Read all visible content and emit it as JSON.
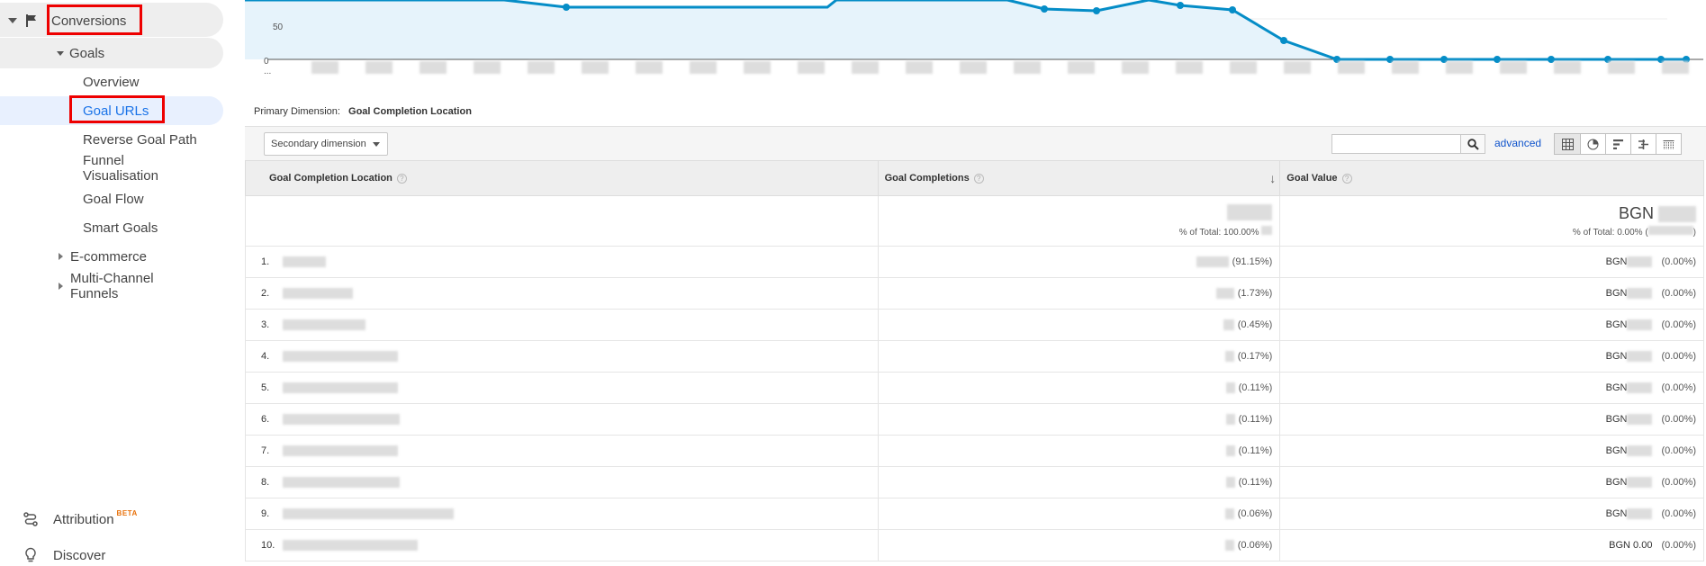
{
  "sidebar": {
    "conversions": "Conversions",
    "goals": "Goals",
    "overview": "Overview",
    "goal_urls": "Goal URLs",
    "reverse_goal_path": "Reverse Goal Path",
    "funnel_line1": "Funnel",
    "funnel_line2": "Visualisation",
    "goal_flow": "Goal Flow",
    "smart_goals": "Smart Goals",
    "ecommerce": "E-commerce",
    "mcf_line1": "Multi-Channel",
    "mcf_line2": "Funnels",
    "attribution": "Attribution",
    "beta": "BETA",
    "discover": "Discover"
  },
  "chart": {
    "y_tick": "50",
    "y_zero": "0",
    "x_ellipsis": "..."
  },
  "primary_dimension": {
    "label": "Primary Dimension:",
    "value": "Goal Completion Location"
  },
  "toolbar": {
    "secondary_dimension": "Secondary dimension",
    "advanced": "advanced"
  },
  "table": {
    "headers": [
      "Goal Completion Location",
      "Goal Completions",
      "Goal Value"
    ],
    "totals": {
      "completions_sub": "% of Total: 100.00%",
      "value_prefix": "BGN",
      "value_sub": "% of Total: 0.00% ("
    },
    "rows": [
      {
        "n": "1.",
        "pct": "(91.15%)",
        "val": "BGN",
        "val_pct": "(0.00%)"
      },
      {
        "n": "2.",
        "pct": "(1.73%)",
        "val": "BGN",
        "val_pct": "(0.00%)"
      },
      {
        "n": "3.",
        "pct": "(0.45%)",
        "val": "BGN",
        "val_pct": "(0.00%)"
      },
      {
        "n": "4.",
        "pct": "(0.17%)",
        "val": "BGN",
        "val_pct": "(0.00%)"
      },
      {
        "n": "5.",
        "pct": "(0.11%)",
        "val": "BGN",
        "val_pct": "(0.00%)"
      },
      {
        "n": "6.",
        "pct": "(0.11%)",
        "val": "BGN",
        "val_pct": "(0.00%)"
      },
      {
        "n": "7.",
        "pct": "(0.11%)",
        "val": "BGN",
        "val_pct": "(0.00%)"
      },
      {
        "n": "8.",
        "pct": "(0.11%)",
        "val": "BGN",
        "val_pct": "(0.00%)"
      },
      {
        "n": "9.",
        "pct": "(0.06%)",
        "val": "BGN",
        "val_pct": "(0.00%)"
      },
      {
        "n": "10.",
        "pct": "(0.06%)",
        "val": "BGN 0.00",
        "val_pct": "(0.00%)"
      }
    ]
  },
  "colors": {
    "line": "#058dc7",
    "fill": "#e6f3fb",
    "highlight_box": "#e00000"
  }
}
